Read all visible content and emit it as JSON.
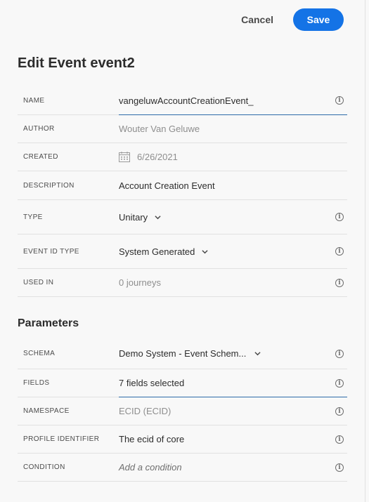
{
  "header": {
    "cancel_label": "Cancel",
    "save_label": "Save",
    "title": "Edit Event event2"
  },
  "event": {
    "name_label": "NAME",
    "name_value": "vangeluwAccountCreationEvent_",
    "author_label": "AUTHOR",
    "author_value": "Wouter Van Geluwe",
    "created_label": "CREATED",
    "created_value": "6/26/2021",
    "description_label": "DESCRIPTION",
    "description_value": "Account Creation Event",
    "type_label": "TYPE",
    "type_value": "Unitary",
    "event_id_type_label": "EVENT ID TYPE",
    "event_id_type_value": "System Generated",
    "used_in_label": "USED IN",
    "used_in_value": "0 journeys"
  },
  "parameters": {
    "title": "Parameters",
    "schema_label": "SCHEMA",
    "schema_value": "Demo System - Event Schem...",
    "fields_label": "FIELDS",
    "fields_value": "7 fields selected",
    "namespace_label": "NAMESPACE",
    "namespace_value": "ECID (ECID)",
    "profile_identifier_label": "PROFILE IDENTIFIER",
    "profile_identifier_value": "The ecid of core",
    "condition_label": "CONDITION",
    "condition_placeholder": "Add a condition"
  },
  "icons": {
    "info": "info-icon",
    "chevron": "chevron-down-icon",
    "calendar": "calendar-icon"
  },
  "colors": {
    "accent": "#1473e6",
    "background": "#f8f8f8"
  }
}
